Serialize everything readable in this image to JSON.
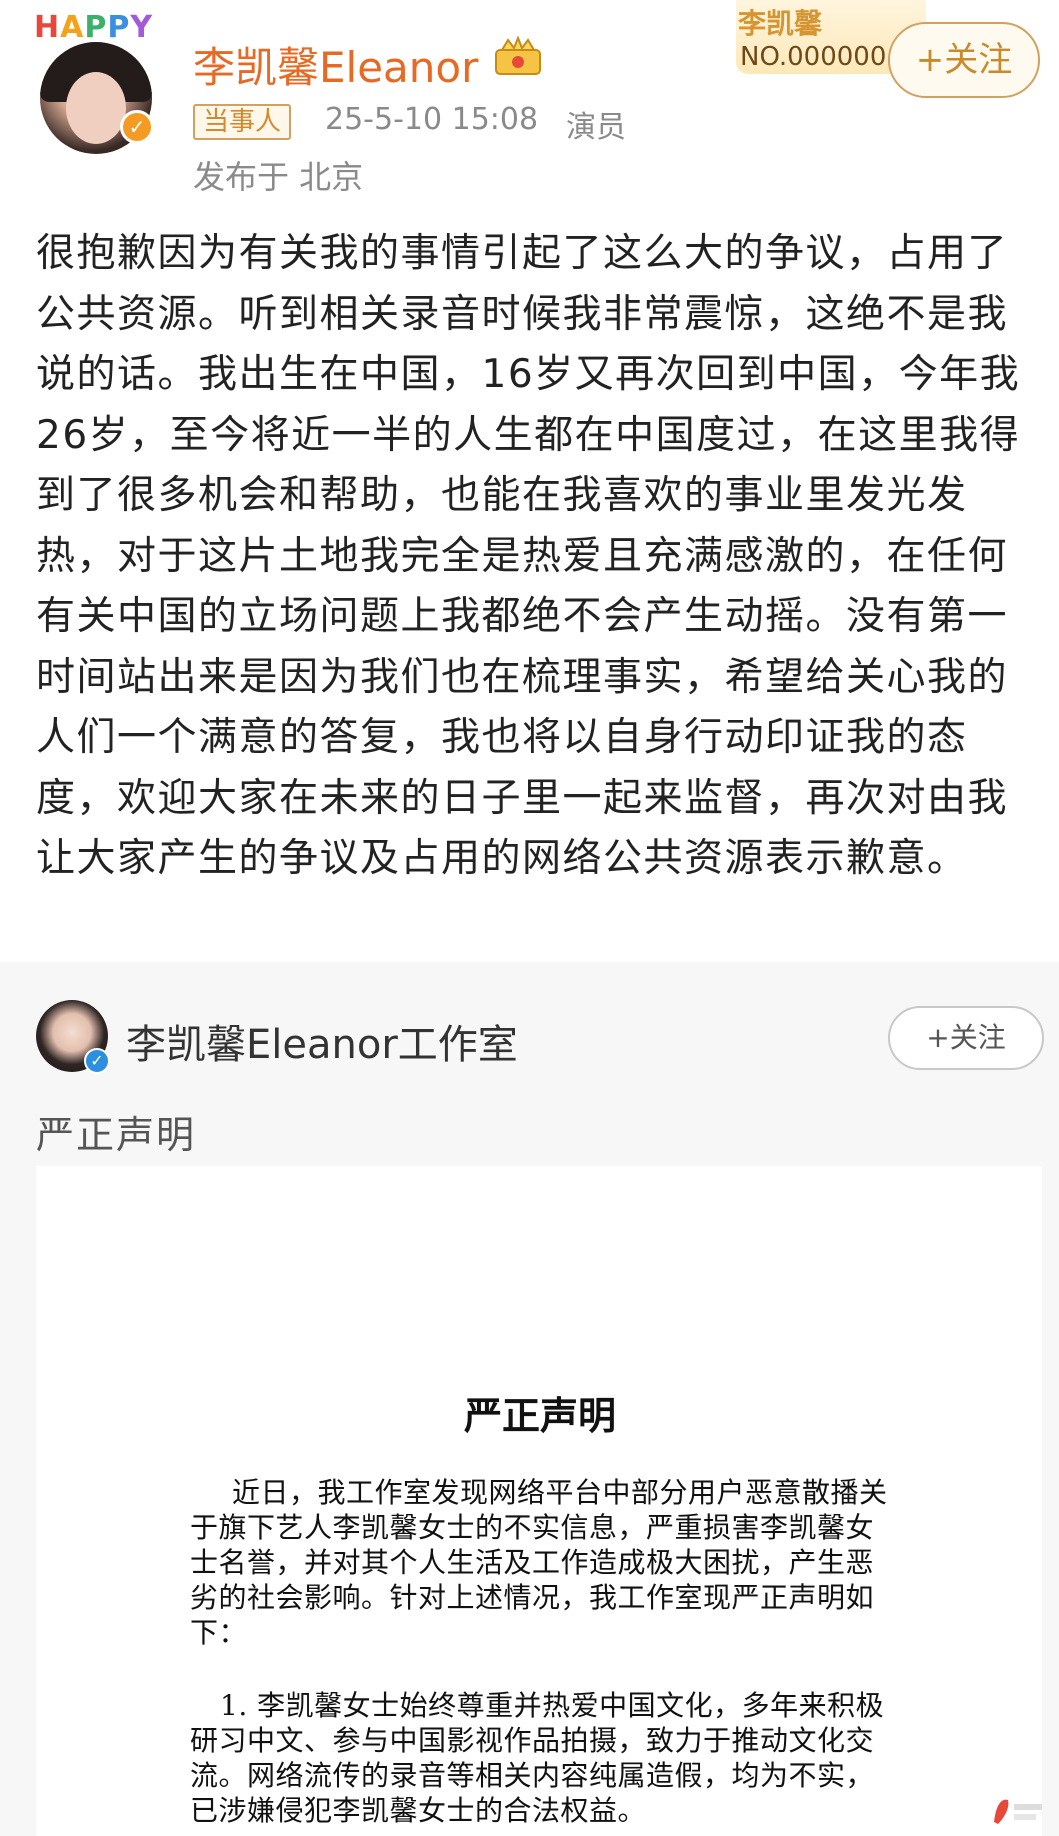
{
  "post": {
    "happy_badge": "HAPPY",
    "username": "李凯馨Eleanor",
    "role_tag": "当事人",
    "time": "25-5-10 15:08",
    "role": "演员",
    "location": "发布于 北京",
    "fan_card_name": "李凯馨",
    "fan_card_number": "NO.000000",
    "follow_label": "+关注",
    "body": "很抱歉因为有关我的事情引起了这么大的争议，占用了公共资源。听到相关录音时候我非常震惊，这绝不是我说的话。我出生在中国，16岁又再次回到中国，今年我26岁，至今将近一半的人生都在中国度过，在这里我得到了很多机会和帮助，也能在我喜欢的事业里发光发热，对于这片土地我完全是热爱且充满感激的，在任何有关中国的立场问题上我都绝不会产生动摇。没有第一时间站出来是因为我们也在梳理事实，希望给关心我的人们一个满意的答复，我也将以自身行动印证我的态度，欢迎大家在未来的日子里一起来监督，再次对由我让大家产生的争议及占用的网络公共资源表示歉意。"
  },
  "repost": {
    "username": "李凯馨Eleanor工作室",
    "follow_label": "+关注",
    "title": "严正声明",
    "statement": {
      "heading": "严正声明",
      "paragraph_1": "近日，我工作室发现网络平台中部分用户恶意散播关于旗下艺人李凯馨女士的不实信息，严重损害李凯馨女士名誉，并对其个人生活及工作造成极大困扰，产生恶劣的社会影响。针对上述情况，我工作室现严正声明如下：",
      "paragraph_2": "1. 李凯馨女士始终尊重并热爱中国文化，多年来积极研习中文、参与中国影视作品拍摄，致力于推动文化交流。网络流传的录音等相关内容纯属造假，均为不实，已涉嫌侵犯李凯馨女士的合法权益。"
    }
  },
  "colors": {
    "username": "#e76a24",
    "meta_gray": "#8a8a8a",
    "tag_border": "#d4a060",
    "verified_orange": "#f59a23",
    "verified_blue": "#2d8fe0"
  },
  "icons": [
    "verified-icon",
    "crown-icon",
    "plus-icon",
    "watermark-icon"
  ]
}
